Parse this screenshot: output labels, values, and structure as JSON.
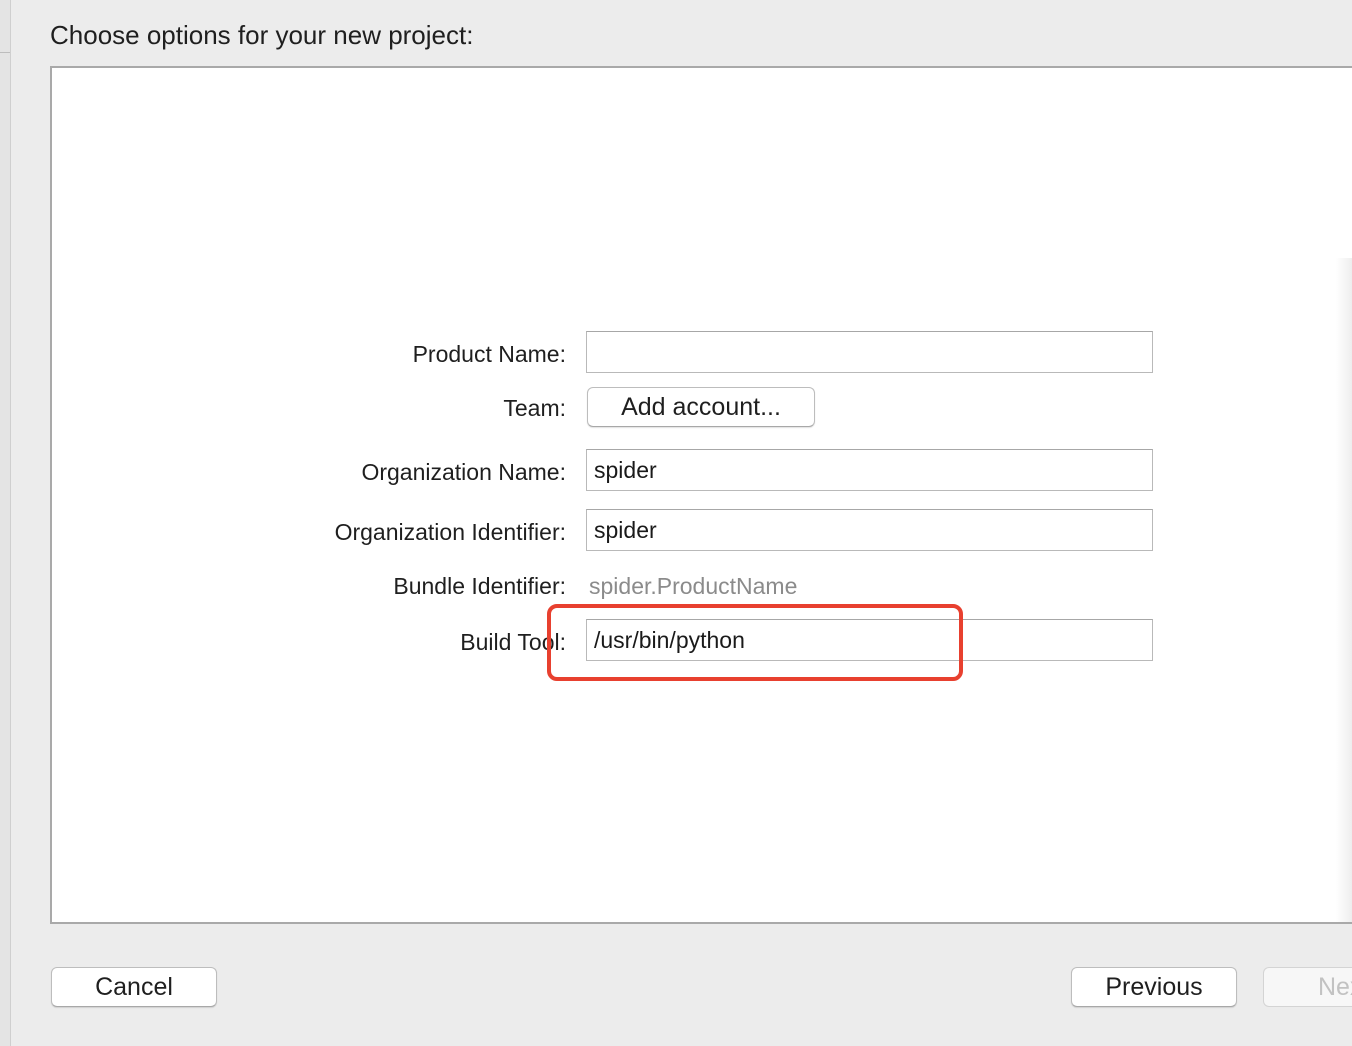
{
  "dialog": {
    "title": "Choose options for your new project:"
  },
  "form": {
    "product_name": {
      "label": "Product Name:",
      "value": ""
    },
    "team": {
      "label": "Team:",
      "button_label": "Add account..."
    },
    "organization_name": {
      "label": "Organization Name:",
      "value": "spider"
    },
    "organization_identifier": {
      "label": "Organization Identifier:",
      "value": "spider"
    },
    "bundle_identifier": {
      "label": "Bundle Identifier:",
      "value": "spider.ProductName"
    },
    "build_tool": {
      "label": "Build Tool:",
      "value": "/usr/bin/python"
    }
  },
  "footer": {
    "cancel_label": "Cancel",
    "previous_label": "Previous",
    "next_label": "Next"
  },
  "colors": {
    "highlight": "#e8402f",
    "window_background": "#ececec",
    "panel_background": "#ffffff",
    "secondary_text": "#8b8b8b"
  }
}
